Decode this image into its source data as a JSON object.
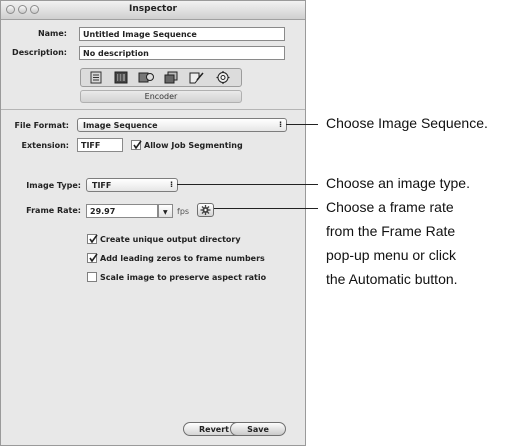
{
  "window": {
    "title": "Inspector"
  },
  "fields": {
    "name_label": "Name:",
    "name_value": "Untitled Image Sequence",
    "description_label": "Description:",
    "description_value": "No description"
  },
  "toolbar": {
    "icons": [
      "summary-icon",
      "encoder-icon",
      "filters-icon",
      "geometry-icon",
      "actions-icon",
      "automatic-icon"
    ]
  },
  "tab": {
    "label": "Encoder"
  },
  "settings": {
    "file_format_label": "File Format:",
    "file_format_value": "Image Sequence",
    "extension_label": "Extension:",
    "extension_value": "TIFF",
    "allow_job_segmenting": "Allow Job Segmenting",
    "image_type_label": "Image Type:",
    "image_type_value": "TIFF",
    "frame_rate_label": "Frame Rate:",
    "frame_rate_value": "29.97",
    "fps_label": "fps",
    "checkbox_unique_dir": "Create unique output directory",
    "checkbox_leading_zeros": "Add leading zeros to frame numbers",
    "checkbox_scale_image": "Scale image to preserve aspect ratio"
  },
  "checkbox_states": {
    "allow_job_segmenting": true,
    "unique_dir": true,
    "leading_zeros": true,
    "scale_image": false
  },
  "buttons": {
    "revert": "Revert",
    "save": "Save"
  },
  "callouts": {
    "file_format": "Choose Image Sequence.",
    "image_type": "Choose an image type.",
    "frame_rate_line1": "Choose a frame rate",
    "frame_rate_line2": "from the Frame Rate",
    "frame_rate_line3": "pop-up menu or click",
    "frame_rate_line4": "the Automatic button."
  }
}
